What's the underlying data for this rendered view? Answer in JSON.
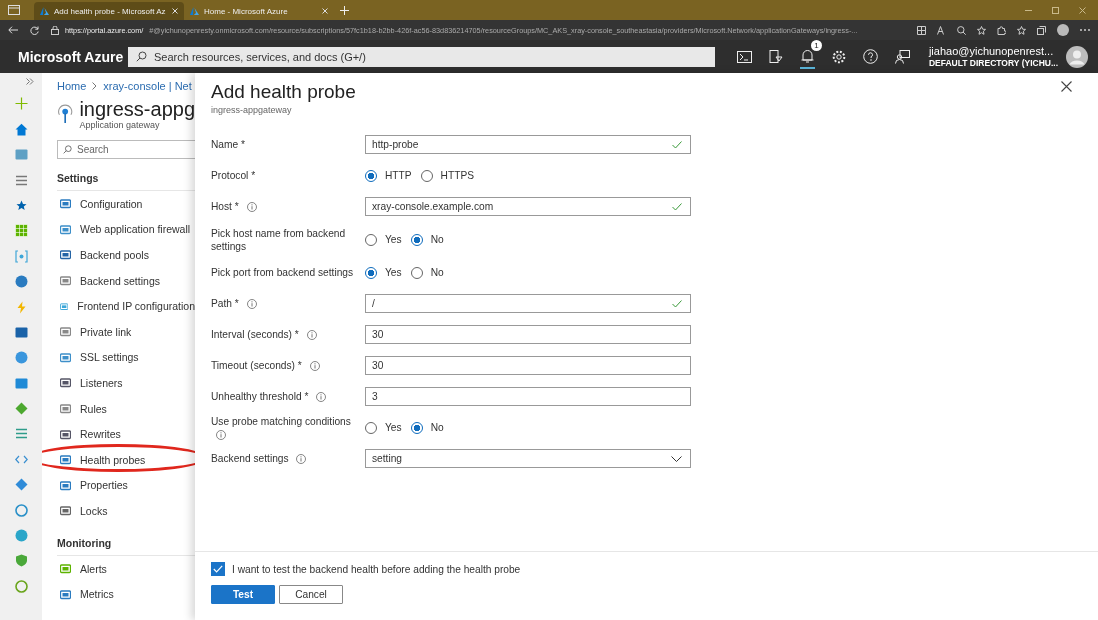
{
  "browser": {
    "tabs": [
      {
        "title": "Add health probe - Microsoft Az",
        "selected": true
      },
      {
        "title": "Home - Microsoft Azure",
        "selected": false
      }
    ],
    "url_host": "https://portal.azure.com/",
    "url_rest": "#@yichunopenresty.onmicrosoft.com/resource/subscriptions/57fc1b18-b2bb-426f-ac56-83d836214705/resourceGroups/MC_AKS_xray-console_southeastasia/providers/Microsoft.Network/applicationGateways/ingress-..."
  },
  "header": {
    "brand": "Microsoft Azure",
    "search_placeholder": "Search resources, services, and docs (G+/)",
    "notification_count": "1",
    "user": "jiahao@yichunopenrest...",
    "directory": "DEFAULT DIRECTORY (YICHU..."
  },
  "nav": {
    "breadcrumb": [
      "Home",
      "xray-console | Net"
    ],
    "resource": "ingress-appg",
    "resource_type": "Application gateway",
    "search_placeholder": "Search",
    "sections": [
      {
        "heading": "Settings",
        "items": [
          {
            "label": "Configuration",
            "circled": false
          },
          {
            "label": "Web application firewall",
            "circled": false
          },
          {
            "label": "Backend pools",
            "circled": false
          },
          {
            "label": "Backend settings",
            "circled": false
          },
          {
            "label": "Frontend IP configuration",
            "circled": false
          },
          {
            "label": "Private link",
            "circled": false
          },
          {
            "label": "SSL settings",
            "circled": false
          },
          {
            "label": "Listeners",
            "circled": false
          },
          {
            "label": "Rules",
            "circled": false
          },
          {
            "label": "Rewrites",
            "circled": false
          },
          {
            "label": "Health probes",
            "circled": true
          },
          {
            "label": "Properties",
            "circled": false
          },
          {
            "label": "Locks",
            "circled": false
          }
        ]
      },
      {
        "heading": "Monitoring",
        "items": [
          {
            "label": "Alerts",
            "circled": false
          },
          {
            "label": "Metrics",
            "circled": false
          }
        ]
      }
    ]
  },
  "panel": {
    "title": "Add health probe",
    "subtitle": "ingress-appgateway",
    "fields": [
      {
        "kind": "text",
        "label": "Name *",
        "info": false,
        "value": "http-probe",
        "valid": true
      },
      {
        "kind": "radio",
        "label": "Protocol *",
        "info": false,
        "options": [
          {
            "label": "HTTP",
            "selected": true
          },
          {
            "label": "HTTPS",
            "selected": false
          }
        ]
      },
      {
        "kind": "text",
        "label": "Host *",
        "info": true,
        "value": "xray-console.example.com",
        "valid": true
      },
      {
        "kind": "radio",
        "label": "Pick host name from backend settings",
        "info": false,
        "options": [
          {
            "label": "Yes",
            "selected": false
          },
          {
            "label": "No",
            "selected": true
          }
        ]
      },
      {
        "kind": "radio",
        "label": "Pick port from backend settings",
        "info": false,
        "options": [
          {
            "label": "Yes",
            "selected": true
          },
          {
            "label": "No",
            "selected": false
          }
        ]
      },
      {
        "kind": "text",
        "label": "Path *",
        "info": true,
        "value": "/",
        "valid": true
      },
      {
        "kind": "text",
        "label": "Interval (seconds) *",
        "info": true,
        "value": "30",
        "valid": false
      },
      {
        "kind": "text",
        "label": "Timeout (seconds) *",
        "info": true,
        "value": "30",
        "valid": false
      },
      {
        "kind": "text",
        "label": "Unhealthy threshold *",
        "info": true,
        "value": "3",
        "valid": false
      },
      {
        "kind": "radio",
        "label": "Use probe matching conditions",
        "info": true,
        "options": [
          {
            "label": "Yes",
            "selected": false
          },
          {
            "label": "No",
            "selected": true
          }
        ]
      },
      {
        "kind": "select",
        "label": "Backend settings",
        "info": true,
        "value": "setting"
      }
    ],
    "test_checkbox": {
      "label": "I want to test the backend health before adding the health probe",
      "checked": true
    },
    "buttons": [
      {
        "label": "Test",
        "kind": "primary"
      },
      {
        "label": "Cancel",
        "kind": "secondary"
      }
    ]
  }
}
